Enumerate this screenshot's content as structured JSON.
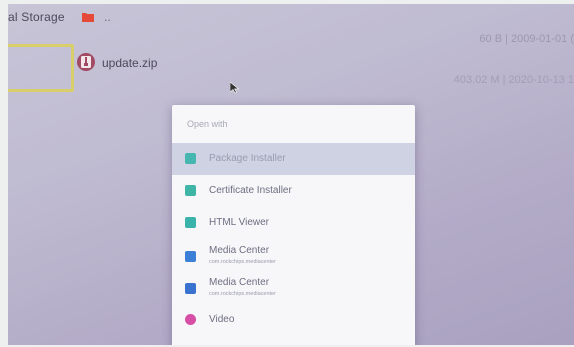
{
  "sidebar": {
    "storage_label": "al Storage"
  },
  "files": [
    {
      "name": "..",
      "meta": "60 B | 2009-01-01 ("
    },
    {
      "name": "update.zip",
      "meta": "403.02 M | 2020-10-13 1"
    }
  ],
  "dialog": {
    "title": "Open with",
    "items": [
      {
        "label": "Package Installer",
        "sub": "",
        "icon": "package-installer-icon",
        "color": "#46b7b0"
      },
      {
        "label": "Certificate Installer",
        "sub": "",
        "icon": "certificate-installer-icon",
        "color": "#3eb5a6"
      },
      {
        "label": "HTML Viewer",
        "sub": "",
        "icon": "html-viewer-icon",
        "color": "#3ab3ad"
      },
      {
        "label": "Media Center",
        "sub": "com.rockchips.mediacenter",
        "icon": "media-center-icon",
        "color": "#3b7fd6"
      },
      {
        "label": "Media Center",
        "sub": "com.rockchips.mediacenter",
        "icon": "media-center-icon",
        "color": "#3a72cf"
      },
      {
        "label": "Video",
        "sub": "",
        "icon": "video-icon",
        "color": "#d64ea6"
      }
    ]
  },
  "colors": {
    "selection_border": "#d8cf6a",
    "zip_icon": "#a24a63",
    "folder_icon": "#e4493a"
  }
}
